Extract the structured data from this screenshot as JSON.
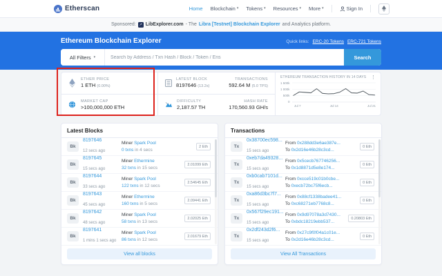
{
  "header": {
    "brand": "Etherscan",
    "nav": [
      {
        "label": "Home",
        "active": true,
        "caret": false
      },
      {
        "label": "Blockchain",
        "caret": true
      },
      {
        "label": "Tokens",
        "caret": true
      },
      {
        "label": "Resources",
        "caret": true
      },
      {
        "label": "More",
        "caret": true
      }
    ],
    "sign_in": "Sign In"
  },
  "icons": {
    "caret_down": "▾",
    "kebab": "⋮",
    "ad_arrow": "↗"
  },
  "sponsored": {
    "label": "Sponsored:",
    "advertiser": "LibExplorer.com",
    "mid": "- The",
    "link": "Libra [Testnet] Blockchain Explorer",
    "suffix": "and Analytics platform."
  },
  "banner": {
    "title": "Ethereum Blockchain Explorer",
    "quick_links_label": "Quick links:",
    "quick_link_1": "ERC-20 Tokens",
    "quick_link_2": "ERC-721 Tokens",
    "filter_label": "All Filters",
    "search_placeholder": "Search by Address / Txn Hash / Block / Token / Ens",
    "search_button": "Search"
  },
  "stats": {
    "ether_price": {
      "label": "ETHER PRICE",
      "value": "1 ETH",
      "change": "(0.00%)"
    },
    "market_cap": {
      "label": "MARKET CAP",
      "value": ">100,000,000 ETH"
    },
    "latest_block": {
      "label": "LATEST BLOCK",
      "value": "8197646",
      "sub": "(13.2s)"
    },
    "transactions": {
      "label": "TRANSACTIONS",
      "value": "592.64 M",
      "sub": "(5.0 TPS)"
    },
    "difficulty": {
      "label": "DIFFICULTY",
      "value": "2,187.57 TH"
    },
    "hash_rate": {
      "label": "HASH RATE",
      "value": "170,560.93 GH/s"
    }
  },
  "chart_data": {
    "type": "line",
    "title": "ETHEREUM TRANSACTION HISTORY IN 14 DAYS",
    "x": [
      "Jul 7",
      "Jul 8",
      "Jul 9",
      "Jul 10",
      "Jul 11",
      "Jul 12",
      "Jul 13",
      "Jul 14",
      "Jul 15",
      "Jul 16",
      "Jul 17",
      "Jul 18",
      "Jul 19",
      "Jul 20",
      "Jul 21"
    ],
    "values_thousands": [
      520,
      790,
      760,
      720,
      1040,
      680,
      640,
      660,
      780,
      1050,
      720,
      700,
      860,
      580,
      550
    ],
    "ylim": [
      0,
      1500
    ],
    "yticks": [
      "1 500k",
      "1 000k",
      "500k",
      "0"
    ],
    "xticks": [
      "Jul 7",
      "Jul 14",
      "Jul 21"
    ],
    "line_color": "#5a6268",
    "grid": true,
    "legend": false
  },
  "blocks": {
    "title": "Latest Blocks",
    "badge": "Bk",
    "miner_label": "Miner",
    "view_all": "View all blocks",
    "rows": [
      {
        "number": "8197646",
        "age": "12 secs ago",
        "miner": "Spark Pool",
        "txns": "0 txns",
        "duration": "in 4 secs",
        "reward": "2 Eth"
      },
      {
        "number": "8197645",
        "age": "15 secs ago",
        "miner": "Ethermine",
        "txns": "32 txns",
        "duration": "in 15 secs",
        "reward": "2.01099 Eth"
      },
      {
        "number": "8197644",
        "age": "33 secs ago",
        "miner": "Spark Pool",
        "txns": "122 txns",
        "duration": "in 12 secs",
        "reward": "2.54645 Eth"
      },
      {
        "number": "8197643",
        "age": "45 secs ago",
        "miner": "Ethermine",
        "txns": "160 txns",
        "duration": "in 5 secs",
        "reward": "2.09441 Eth"
      },
      {
        "number": "8197642",
        "age": "48 secs ago",
        "miner": "Spark Pool",
        "txns": "58 txns",
        "duration": "in 13 secs",
        "reward": "2.02025 Eth"
      },
      {
        "number": "8197641",
        "age": "1 mins 1 secs ago",
        "miner": "Spark Pool",
        "txns": "86 txns",
        "duration": "in 12 secs",
        "reward": "2.01679 Eth"
      }
    ]
  },
  "txs": {
    "title": "Transactions",
    "badge": "Tx",
    "from_label": "From",
    "to_label": "To",
    "view_all": "View All Transactions",
    "rows": [
      {
        "hash": "0x38700ec598...",
        "age": "15 secs ago",
        "from": "0x288dd3e6ae387e...",
        "to": "0x2d16e46b28c3cd...",
        "value": "0 Eth"
      },
      {
        "hash": "0xeb7da49328...",
        "age": "15 secs ago",
        "from": "0x5cecb767746256...",
        "to": "0x1d8871d5e8e174...",
        "value": "0 Eth"
      },
      {
        "hash": "0xb0cab7101d...",
        "age": "15 secs ago",
        "from": "0xcce519c01b0cbe...",
        "to": "0xecb72bc75f6ecb...",
        "value": "0 Eth"
      },
      {
        "hash": "0xa86d3bc7f7...",
        "age": "15 secs ago",
        "from": "0x88cf1338badee41...",
        "to": "0xc68271eb7768c8...",
        "value": "0 Eth"
      },
      {
        "hash": "0x567f29ec191...",
        "age": "15 secs ago",
        "from": "0x9d97078a3d7430...",
        "to": "0xbdc18219ebb537...",
        "value": "0.20803 Eth"
      },
      {
        "hash": "0x2df243d2f6...",
        "age": "15 secs ago",
        "from": "0x27c9f0f04a1c01e...",
        "to": "0x2d16e46b28c3cd...",
        "value": "0 Eth"
      }
    ]
  },
  "annotation": {
    "color": "#dd201b",
    "target": "ether-price-and-market-cap"
  }
}
